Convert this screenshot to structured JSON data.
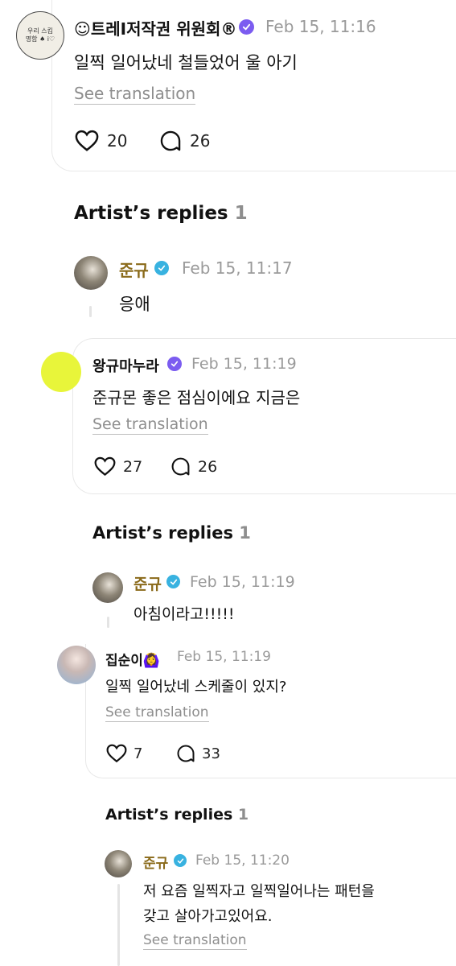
{
  "threads": [
    {
      "author": "☺트레I저작권 위원회®",
      "time": "Feb 15, 11:16",
      "text": "일찍 일어났네 철들었어 울 아기",
      "see_translation": "See translation",
      "likes": "20",
      "comments": "26",
      "avatar_text": [
        "우리 스킴",
        "명함 ♠ i♡"
      ]
    },
    {
      "author": "왕규마누라",
      "time": "Feb 15, 11:19",
      "text": "준규몬 좋은 점심이에요 지금은",
      "see_translation": "See translation",
      "likes": "27",
      "comments": "26"
    },
    {
      "author": "집순이🙆‍♀️",
      "time": "Feb 15, 11:19",
      "text": "일찍 일어났네 스케줄이 있지?",
      "see_translation": "See translation",
      "likes": "7",
      "comments": "33"
    }
  ],
  "artist_replies": [
    {
      "heading": "Artist’s replies",
      "count": "1",
      "author": "준규",
      "time": "Feb 15, 11:17",
      "text": "응애"
    },
    {
      "heading": "Artist’s replies",
      "count": "1",
      "author": "준규",
      "time": "Feb 15, 11:19",
      "text": "아침이라고!!!!!"
    },
    {
      "heading": "Artist’s replies",
      "count": "1",
      "author": "준규",
      "time": "Feb 15, 11:20",
      "text_line1": "저 요즘 일찍자고 일찍일어나는 패턴을",
      "text_line2": "갖고 살아가고있어요.",
      "see_translation": "See translation"
    }
  ],
  "colors": {
    "artist_name": "#8a6a1a",
    "artist_badge": "#38b2e0",
    "fan_badge": "#7b5cf0",
    "highlight_avatar": "#e8f53a"
  },
  "icons": [
    "heart-icon",
    "comment-icon",
    "verified-badge-icon"
  ]
}
